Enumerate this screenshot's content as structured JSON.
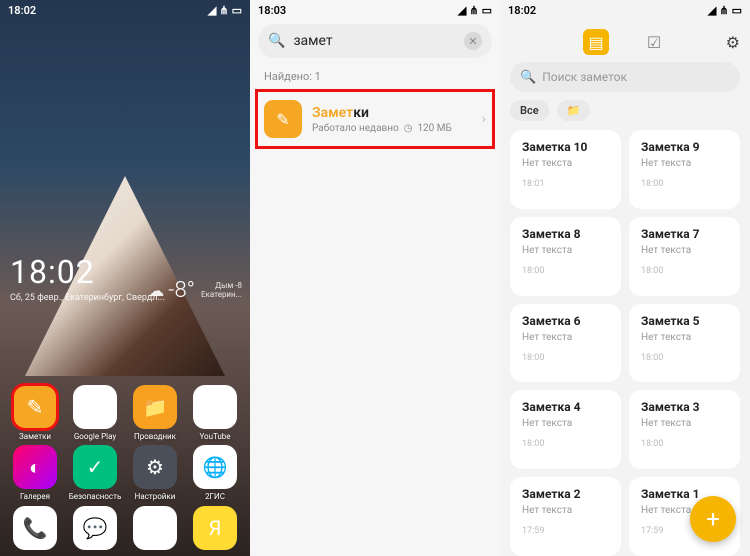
{
  "p1": {
    "status_time": "18:02",
    "clock": "18:02",
    "date": "Сб, 25 февр., Екатеринбург, Свердл...",
    "temp": "-8°",
    "weather_sub1": "Дым -8",
    "weather_sub2": "Екатерин...",
    "apps": [
      {
        "label": "Заметки",
        "class": "c-notes",
        "glyph": "✎",
        "name": "app-notes",
        "hl": true
      },
      {
        "label": "Google Play",
        "class": "c-play",
        "glyph": "▶",
        "name": "app-play"
      },
      {
        "label": "Проводник",
        "class": "c-folder",
        "glyph": "📁",
        "name": "app-files"
      },
      {
        "label": "YouTube",
        "class": "c-yt",
        "glyph": "▶",
        "name": "app-youtube"
      },
      {
        "label": "Галерея",
        "class": "c-gal",
        "glyph": "◐",
        "name": "app-gallery"
      },
      {
        "label": "Безопасность",
        "class": "c-sec",
        "glyph": "✓",
        "name": "app-security"
      },
      {
        "label": "Настройки",
        "class": "c-set",
        "glyph": "⚙",
        "name": "app-settings"
      },
      {
        "label": "2ГИС",
        "class": "c-2gis",
        "glyph": "🌐",
        "name": "app-2gis"
      }
    ],
    "dock": [
      {
        "class": "c-ph",
        "glyph": "📞",
        "name": "dock-phone"
      },
      {
        "class": "c-msg",
        "glyph": "💬",
        "name": "dock-messages"
      },
      {
        "class": "c-gp",
        "glyph": "▶",
        "name": "dock-play"
      },
      {
        "class": "c-ya",
        "glyph": "Я",
        "name": "dock-yandex"
      }
    ]
  },
  "p2": {
    "status_time": "18:03",
    "query": "замет",
    "found": "Найдено: 1",
    "result": {
      "match": "Замет",
      "rest": "ки",
      "sub1": "Работало недавно",
      "size": "120 МБ"
    }
  },
  "p3": {
    "status_time": "18:02",
    "search_ph": "Поиск заметок",
    "filter_all": "Все",
    "notes": [
      {
        "t": "Заметка 10",
        "s": "Нет текста",
        "time": "18:01"
      },
      {
        "t": "Заметка 9",
        "s": "Нет текста",
        "time": "18:00"
      },
      {
        "t": "Заметка 8",
        "s": "Нет текста",
        "time": "18:00"
      },
      {
        "t": "Заметка 7",
        "s": "Нет текста",
        "time": "18:00"
      },
      {
        "t": "Заметка 6",
        "s": "Нет текста",
        "time": "18:00"
      },
      {
        "t": "Заметка 5",
        "s": "Нет текста",
        "time": "18:00"
      },
      {
        "t": "Заметка 4",
        "s": "Нет текста",
        "time": "18:00"
      },
      {
        "t": "Заметка 3",
        "s": "Нет текста",
        "time": "18:00"
      },
      {
        "t": "Заметка 2",
        "s": "Нет текста",
        "time": "17:59"
      },
      {
        "t": "Заметка 1",
        "s": "Нет текста",
        "time": "17:59"
      }
    ]
  }
}
